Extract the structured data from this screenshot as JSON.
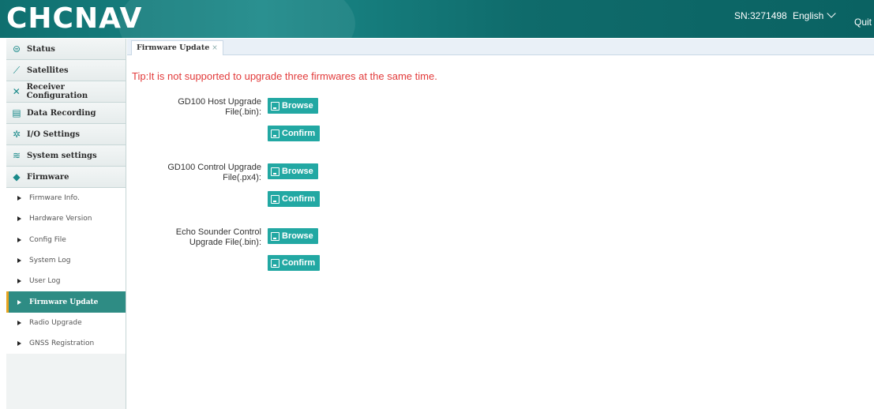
{
  "header": {
    "logo": "CHCNAV",
    "sn": "SN:3271498",
    "language": "English",
    "quit": "Quit"
  },
  "sidebar": {
    "menu": [
      {
        "label": "Status",
        "icon": "status-icon"
      },
      {
        "label": "Satellites",
        "icon": "satellite-icon"
      },
      {
        "label": "Receiver Configuration",
        "icon": "tools-icon"
      },
      {
        "label": "Data Recording",
        "icon": "record-icon"
      },
      {
        "label": "I/O Settings",
        "icon": "gear-icon"
      },
      {
        "label": "System settings",
        "icon": "wifi-icon"
      },
      {
        "label": "Firmware",
        "icon": "firmware-icon"
      }
    ],
    "submenu": [
      "Firmware Info.",
      "Hardware Version",
      "Config File",
      "System Log",
      "User Log",
      "Firmware Update",
      "Radio Upgrade",
      "GNSS Registration"
    ],
    "active_submenu": "Firmware Update"
  },
  "tabs": [
    {
      "label": "Firmware Update",
      "close": "×"
    }
  ],
  "content": {
    "tip": "Tip:It is not supported to upgrade three firmwares at the same time.",
    "sections": [
      {
        "label_line1": "GD100 Host Upgrade",
        "label_line2": "File(.bin):",
        "browse": "Browse",
        "confirm": "Confirm"
      },
      {
        "label_line1": "GD100 Control Upgrade",
        "label_line2": "File(.px4):",
        "browse": "Browse",
        "confirm": "Confirm"
      },
      {
        "label_line1": "Echo Sounder Control",
        "label_line2": "Upgrade File(.bin):",
        "browse": "Browse",
        "confirm": "Confirm"
      }
    ]
  },
  "colors": {
    "header_bg": "#0f6f6f",
    "accent": "#22a8a3",
    "active_item": "#2e8c84",
    "active_marker": "#e8a41f",
    "tip": "#e23b3b"
  }
}
